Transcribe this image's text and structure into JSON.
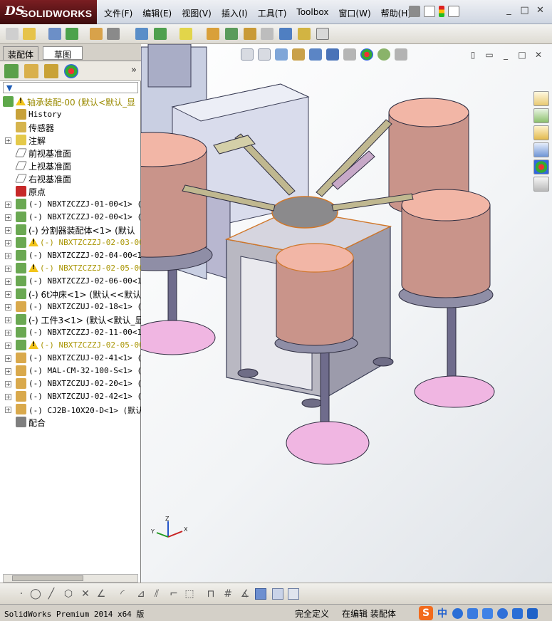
{
  "app": {
    "brand": "SOLIDWORKS",
    "brand_prefix": "DS",
    "menus": [
      "文件(F)",
      "编辑(E)",
      "视图(V)",
      "插入(I)",
      "工具(T)",
      "Toolbox",
      "窗口(W)",
      "帮助(H)"
    ],
    "window_controls": [
      "_",
      "□",
      "✕"
    ]
  },
  "panel": {
    "tabs": [
      "装配体",
      "草图"
    ],
    "more_glyph": "»",
    "filter_glyph": "▼"
  },
  "tree": {
    "items": [
      {
        "label": "轴承装配-00  (默认<默认_显",
        "icon": "assembly-icon",
        "warning": true,
        "expandable": false,
        "indent": 0,
        "style": "root"
      },
      {
        "label": "History",
        "icon": "history-icon",
        "warning": false,
        "expandable": false,
        "indent": 1,
        "style": "plain"
      },
      {
        "label": "传感器",
        "icon": "sensor-icon",
        "warning": false,
        "expandable": false,
        "indent": 1,
        "style": "cn"
      },
      {
        "label": "注解",
        "icon": "annotation-icon",
        "warning": false,
        "expandable": true,
        "indent": 1,
        "style": "cn"
      },
      {
        "label": "前视基准面",
        "icon": "plane-icon",
        "warning": false,
        "expandable": false,
        "indent": 1,
        "style": "cn"
      },
      {
        "label": "上视基准面",
        "icon": "plane-icon",
        "warning": false,
        "expandable": false,
        "indent": 1,
        "style": "cn"
      },
      {
        "label": "右视基准面",
        "icon": "plane-icon",
        "warning": false,
        "expandable": false,
        "indent": 1,
        "style": "cn"
      },
      {
        "label": "原点",
        "icon": "origin-icon",
        "warning": false,
        "expandable": false,
        "indent": 1,
        "style": "cn"
      },
      {
        "label": "(-) NBXTZCZZJ-01-00<1> (",
        "icon": "subassembly-icon",
        "warning": false,
        "expandable": true,
        "indent": 1,
        "style": "plain"
      },
      {
        "label": "(-) NBXTZCZZJ-02-00<1> (",
        "icon": "subassembly-icon",
        "warning": false,
        "expandable": true,
        "indent": 1,
        "style": "plain"
      },
      {
        "label": "(-) 分割器装配体<1> (默认",
        "icon": "subassembly-icon",
        "warning": false,
        "expandable": true,
        "indent": 1,
        "style": "cn"
      },
      {
        "label": "(-) NBXTZCZZJ-02-03-00",
        "icon": "subassembly-icon",
        "warning": true,
        "expandable": true,
        "indent": 1,
        "style": "warn"
      },
      {
        "label": "(-) NBXTZCZZJ-02-04-00<1",
        "icon": "subassembly-icon",
        "warning": false,
        "expandable": true,
        "indent": 1,
        "style": "plain"
      },
      {
        "label": "(-) NBXTZCZZJ-02-05-00",
        "icon": "subassembly-icon",
        "warning": true,
        "expandable": true,
        "indent": 1,
        "style": "warn"
      },
      {
        "label": "(-) NBXTZCZZJ-02-06-00<1",
        "icon": "subassembly-icon",
        "warning": false,
        "expandable": true,
        "indent": 1,
        "style": "plain"
      },
      {
        "label": "(-) 6t冲床<1> (默认<<默认",
        "icon": "subassembly-icon",
        "warning": false,
        "expandable": true,
        "indent": 1,
        "style": "cn"
      },
      {
        "label": "(-) NBXTZCZUJ-02-18<1> (",
        "icon": "part-icon",
        "warning": false,
        "expandable": true,
        "indent": 1,
        "style": "plain"
      },
      {
        "label": "(-) 工件3<1> (默认<默认_显",
        "icon": "subassembly-icon",
        "warning": false,
        "expandable": true,
        "indent": 1,
        "style": "cn"
      },
      {
        "label": "(-) NBXTZCZZJ-02-11-00<1",
        "icon": "subassembly-icon",
        "warning": false,
        "expandable": true,
        "indent": 1,
        "style": "plain"
      },
      {
        "label": "(-) NBXTZCZZJ-02-05-00",
        "icon": "subassembly-icon",
        "warning": true,
        "expandable": true,
        "indent": 1,
        "style": "warn"
      },
      {
        "label": "(-) NBXTZCZUJ-02-41<1> (",
        "icon": "part-icon",
        "warning": false,
        "expandable": true,
        "indent": 1,
        "style": "plain"
      },
      {
        "label": "(-) MAL-CM-32-100-S<1> (",
        "icon": "part-icon",
        "warning": false,
        "expandable": true,
        "indent": 1,
        "style": "plain"
      },
      {
        "label": "(-) NBXTZCZUJ-02-20<1> (",
        "icon": "part-icon",
        "warning": false,
        "expandable": true,
        "indent": 1,
        "style": "plain"
      },
      {
        "label": "(-) NBXTZCZUJ-02-42<1> (",
        "icon": "part-icon",
        "warning": false,
        "expandable": true,
        "indent": 1,
        "style": "plain"
      },
      {
        "label": "(-) CJ2B-10X20-D<1> (默认",
        "icon": "part-icon",
        "warning": false,
        "expandable": true,
        "indent": 1,
        "style": "plain"
      },
      {
        "label": "配合",
        "icon": "mates-icon",
        "warning": false,
        "expandable": false,
        "indent": 1,
        "style": "cn"
      }
    ]
  },
  "viewport": {
    "triad_labels": {
      "x": "X",
      "y": "Y",
      "z": "Z"
    },
    "colors": {
      "bowl": "#c9948a",
      "bowl_top": "#f2b6a6",
      "base_plate": "#f0b6e2",
      "frame": "#c9cfe2",
      "stand": "#6f6c8c",
      "arm": "#c0b890",
      "cabinet": "#b4b2c8"
    }
  },
  "status": {
    "app_version": "SolidWorks Premium 2014 x64 版",
    "definition": "完全定义",
    "mode": "在编辑 装配体",
    "ime_brand": "S",
    "ime_lang": "中"
  }
}
